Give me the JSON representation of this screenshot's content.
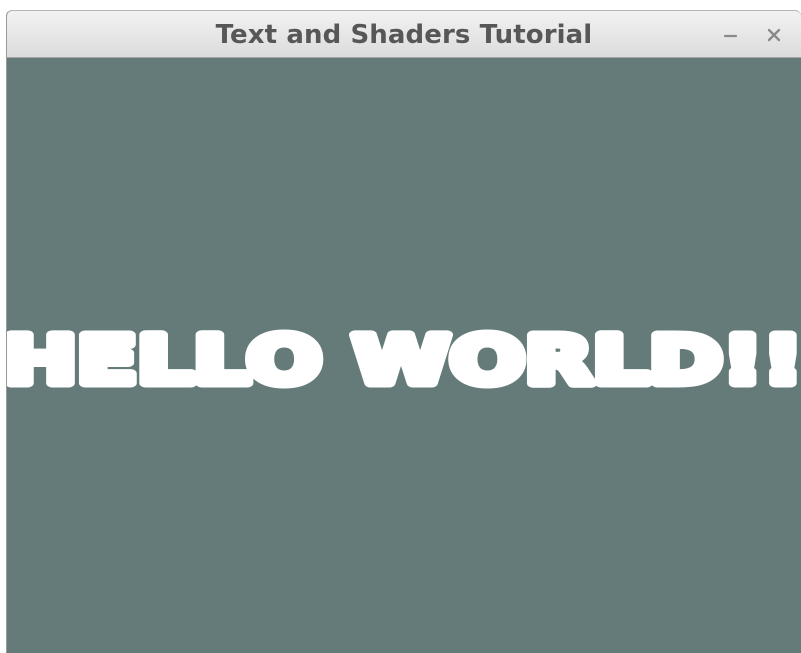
{
  "window": {
    "title": "Text and Shaders Tutorial",
    "minimize_icon": "minimize-icon",
    "close_icon": "close-icon"
  },
  "canvas": {
    "text": "HELLO WORLD!!",
    "background_color": "#647b7a",
    "text_color": "#ffffff"
  }
}
